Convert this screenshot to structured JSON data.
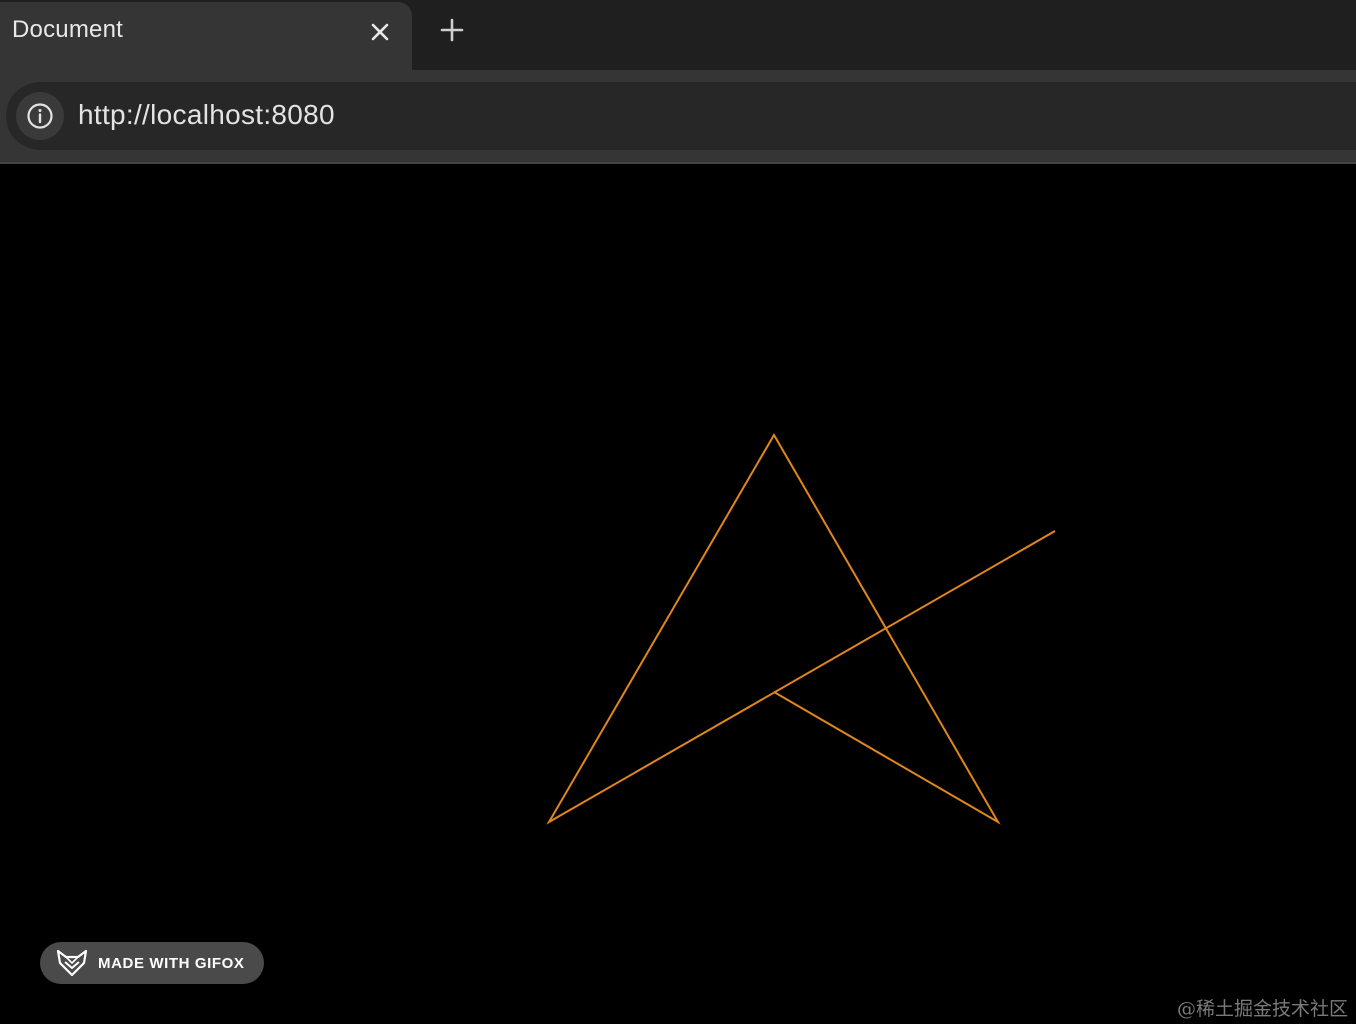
{
  "tab": {
    "title": "Document"
  },
  "address_bar": {
    "url": "http://localhost:8080"
  },
  "canvas": {
    "stroke_color": "#e0861d",
    "background": "#000000"
  },
  "badge": {
    "text": "MADE WITH GIFOX"
  },
  "watermark": {
    "text": "@稀土掘金技术社区"
  },
  "colors": {
    "tabstrip_bg": "#1f1f1f",
    "active_tab_bg": "#353535",
    "omnibox_bg": "#272727"
  },
  "icons": [
    "close-icon",
    "plus-icon",
    "info-icon",
    "fox-icon"
  ]
}
